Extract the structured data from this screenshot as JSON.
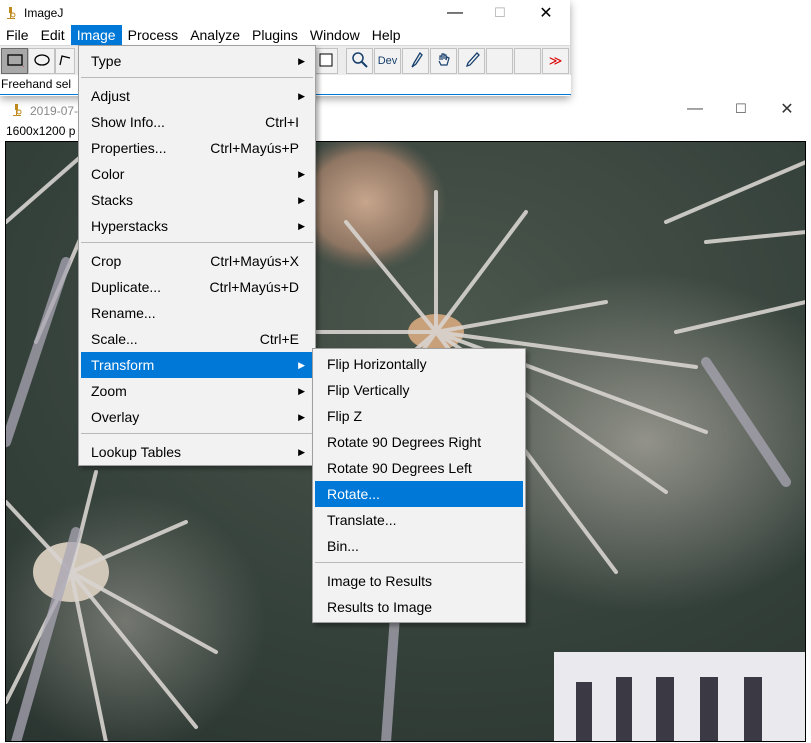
{
  "app": {
    "title": "ImageJ",
    "status_text": "Freehand sel",
    "menus": [
      "File",
      "Edit",
      "Image",
      "Process",
      "Analyze",
      "Plugins",
      "Window",
      "Help"
    ],
    "active_menu": "Image",
    "window_controls": {
      "minimize": "—",
      "maximize": "☐",
      "close": "✕"
    },
    "toolbar": {
      "dev_label": "Dev",
      "more_label": "≫"
    }
  },
  "image_window": {
    "title": "2019-07-",
    "info": "1600x1200 p"
  },
  "image_menu": {
    "items": [
      {
        "label": "Type",
        "submenu": true
      },
      {
        "label": "Adjust",
        "submenu": true
      },
      {
        "label": "Show Info...",
        "shortcut": "Ctrl+I"
      },
      {
        "label": "Properties...",
        "shortcut": "Ctrl+Mayús+P"
      },
      {
        "label": "Color",
        "submenu": true
      },
      {
        "label": "Stacks",
        "submenu": true
      },
      {
        "label": "Hyperstacks",
        "submenu": true
      },
      {
        "label": "Crop",
        "shortcut": "Ctrl+Mayús+X"
      },
      {
        "label": "Duplicate...",
        "shortcut": "Ctrl+Mayús+D"
      },
      {
        "label": "Rename..."
      },
      {
        "label": "Scale...",
        "shortcut": "Ctrl+E"
      },
      {
        "label": "Transform",
        "submenu": true,
        "highlighted": true
      },
      {
        "label": "Zoom",
        "submenu": true
      },
      {
        "label": "Overlay",
        "submenu": true
      },
      {
        "label": "Lookup Tables",
        "submenu": true
      }
    ]
  },
  "transform_menu": {
    "items": [
      {
        "label": "Flip Horizontally"
      },
      {
        "label": "Flip Vertically"
      },
      {
        "label": "Flip Z"
      },
      {
        "label": "Rotate 90 Degrees Right"
      },
      {
        "label": "Rotate 90 Degrees Left"
      },
      {
        "label": "Rotate...",
        "highlighted": true
      },
      {
        "label": "Translate..."
      },
      {
        "label": "Bin..."
      },
      {
        "label": "Image to Results"
      },
      {
        "label": "Results to Image"
      }
    ]
  },
  "colors": {
    "accent": "#0078d7",
    "menu_bg": "#f2f2f2"
  }
}
